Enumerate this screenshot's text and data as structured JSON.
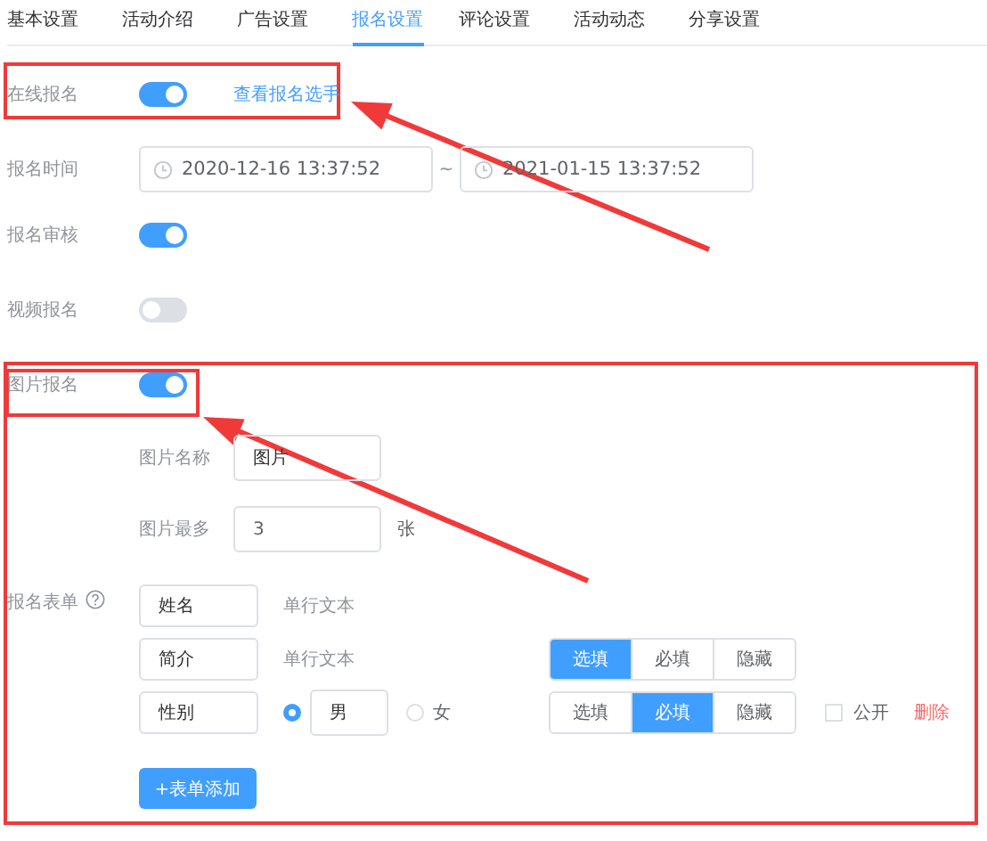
{
  "tabs": [
    {
      "label": "基本设置",
      "selected": false
    },
    {
      "label": "活动介绍",
      "selected": false
    },
    {
      "label": "广告设置",
      "selected": false
    },
    {
      "label": "报名设置",
      "selected": true
    },
    {
      "label": "评论设置",
      "selected": false
    },
    {
      "label": "活动动态",
      "selected": false
    },
    {
      "label": "分享设置",
      "selected": false
    }
  ],
  "online_signup": {
    "label": "在线报名",
    "on": true,
    "link": "查看报名选手"
  },
  "signup_time": {
    "label": "报名时间",
    "start": "2020-12-16 13:37:52",
    "separator": "~",
    "end": "2021-01-15 13:37:52"
  },
  "review": {
    "label": "报名审核",
    "on": true
  },
  "video_signup": {
    "label": "视频报名",
    "on": false
  },
  "photo_signup": {
    "label": "图片报名",
    "on": true,
    "name": {
      "label": "图片名称",
      "value": "图片"
    },
    "max": {
      "label": "图片最多",
      "value": "3",
      "unit": "张"
    }
  },
  "form": {
    "label": "报名表单",
    "fields": [
      {
        "kind": "text",
        "value": "姓名",
        "type_label": "单行文本"
      },
      {
        "kind": "text",
        "value": "简介",
        "type_label": "单行文本",
        "options": [
          {
            "label": "选填",
            "selected": true
          },
          {
            "label": "必填",
            "selected": false
          },
          {
            "label": "隐藏",
            "selected": false
          }
        ]
      },
      {
        "kind": "radio",
        "value": "性别",
        "choices": [
          {
            "kind": "input",
            "label": "男",
            "selected": true
          },
          {
            "kind": "plain",
            "label": "女",
            "selected": false
          }
        ],
        "options": [
          {
            "label": "选填",
            "selected": false
          },
          {
            "label": "必填",
            "selected": true
          },
          {
            "label": "隐藏",
            "selected": false
          }
        ],
        "public": {
          "label": "公开",
          "checked": false
        },
        "delete": "删除"
      }
    ],
    "add_button": "+表单添加"
  }
}
